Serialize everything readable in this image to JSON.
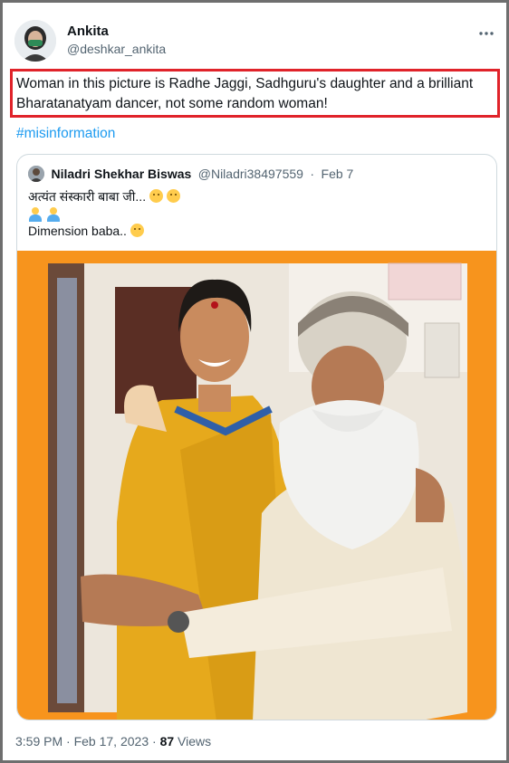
{
  "author": {
    "name": "Ankita",
    "handle": "@deshkar_ankita"
  },
  "more_icon": "more-horizontal-icon",
  "tweet": {
    "text": "Woman in this picture is Radhe Jaggi, Sadhguru's daughter and a brilliant Bharatanatyam dancer, not some random woman!",
    "highlight_color": "#e0232a",
    "hashtag": "#misinformation"
  },
  "quoted": {
    "name": "Niladri Shekhar Biswas",
    "handle": "@Niladri38497559",
    "separator": "·",
    "date": "Feb 7",
    "line1": "अत्यंत संस्कारी बाबा जी...",
    "line3": "Dimension baba..",
    "emoji": [
      "thinking-face",
      "thinking-face",
      "man-facepalming",
      "man-facepalming",
      "shushing-face"
    ],
    "photo_border_color": "#f7941d"
  },
  "footer": {
    "time": "3:59 PM",
    "separator": "·",
    "date": "Feb 17, 2023",
    "separator2": "·",
    "views_count": "87",
    "views_label": "Views"
  },
  "colors": {
    "link": "#1d9bf0",
    "secondary_text": "#536471"
  }
}
